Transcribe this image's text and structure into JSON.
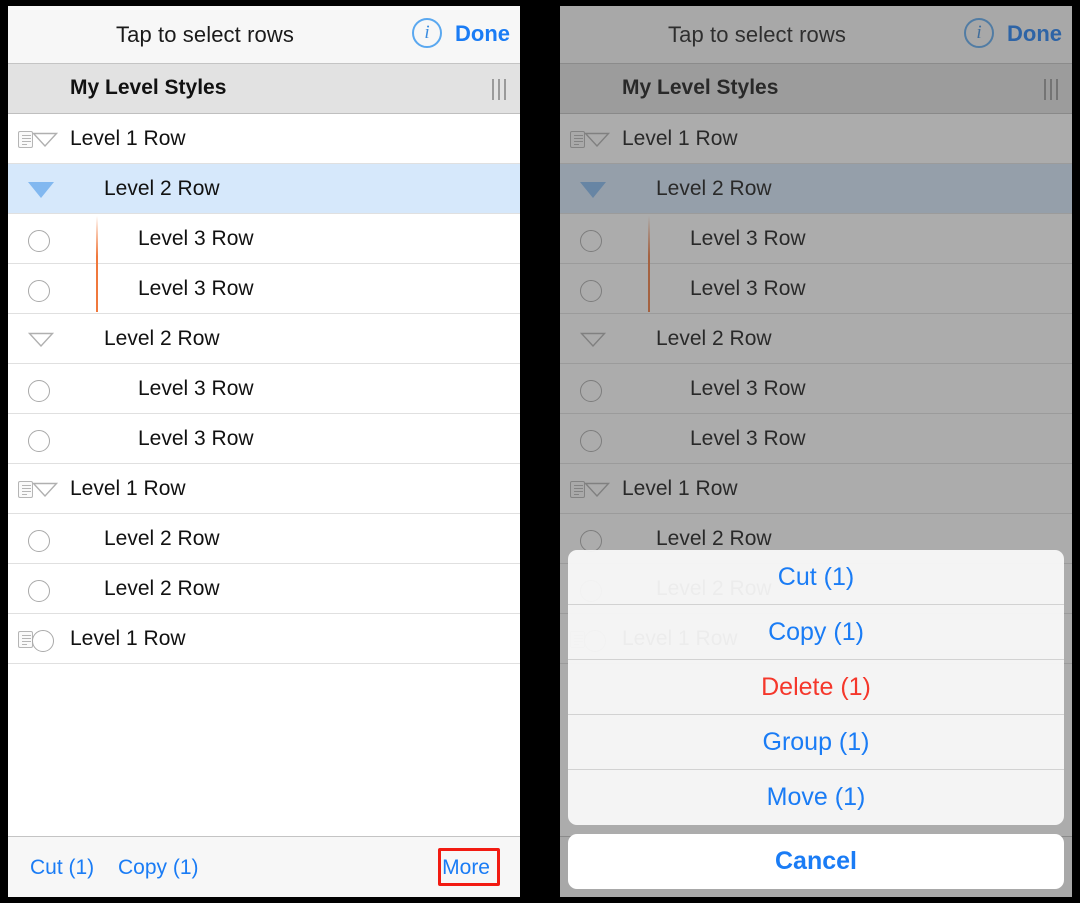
{
  "navbar": {
    "title": "Tap to select rows",
    "info_icon": "info-circle-icon",
    "info_glyph": "i",
    "done_label": "Done"
  },
  "section": {
    "title": "My Level Styles",
    "grip_icon": "reorder-grip-icon"
  },
  "rows": [
    {
      "label": "Level 1 Row",
      "level": 1,
      "handle": "triangle-outline",
      "note": true,
      "selected": false
    },
    {
      "label": "Level 2 Row",
      "level": 2,
      "handle": "triangle-filled",
      "note": false,
      "selected": true
    },
    {
      "label": "Level 3 Row",
      "level": 3,
      "handle": "circle",
      "note": false,
      "selected": false
    },
    {
      "label": "Level 3 Row",
      "level": 3,
      "handle": "circle",
      "note": false,
      "selected": false
    },
    {
      "label": "Level 2 Row",
      "level": 2,
      "handle": "triangle-outline",
      "note": false,
      "selected": false
    },
    {
      "label": "Level 3 Row",
      "level": 3,
      "handle": "circle",
      "note": false,
      "selected": false
    },
    {
      "label": "Level 3 Row",
      "level": 3,
      "handle": "circle",
      "note": false,
      "selected": false
    },
    {
      "label": "Level 1 Row",
      "level": 1,
      "handle": "triangle-outline",
      "note": true,
      "selected": false
    },
    {
      "label": "Level 2 Row",
      "level": 2,
      "handle": "circle",
      "note": false,
      "selected": false
    },
    {
      "label": "Level 2 Row",
      "level": 2,
      "handle": "circle",
      "note": false,
      "selected": false
    },
    {
      "label": "Level 1 Row",
      "level": 1,
      "handle": "circle",
      "note": true,
      "selected": false
    }
  ],
  "toolbar": {
    "cut_label": "Cut (1)",
    "copy_label": "Copy (1)",
    "more_label": "More",
    "highlight_color": "#f21b12"
  },
  "action_sheet": {
    "buttons": [
      {
        "label": "Cut (1)",
        "style": "default"
      },
      {
        "label": "Copy (1)",
        "style": "default"
      },
      {
        "label": "Delete (1)",
        "style": "destructive"
      },
      {
        "label": "Group (1)",
        "style": "default"
      },
      {
        "label": "Move (1)",
        "style": "default"
      }
    ],
    "cancel_label": "Cancel"
  },
  "colors": {
    "accent": "#1a7cf5",
    "destructive": "#f5372b",
    "selected_row": "#d6e8fb",
    "connector": "#f0783c"
  }
}
